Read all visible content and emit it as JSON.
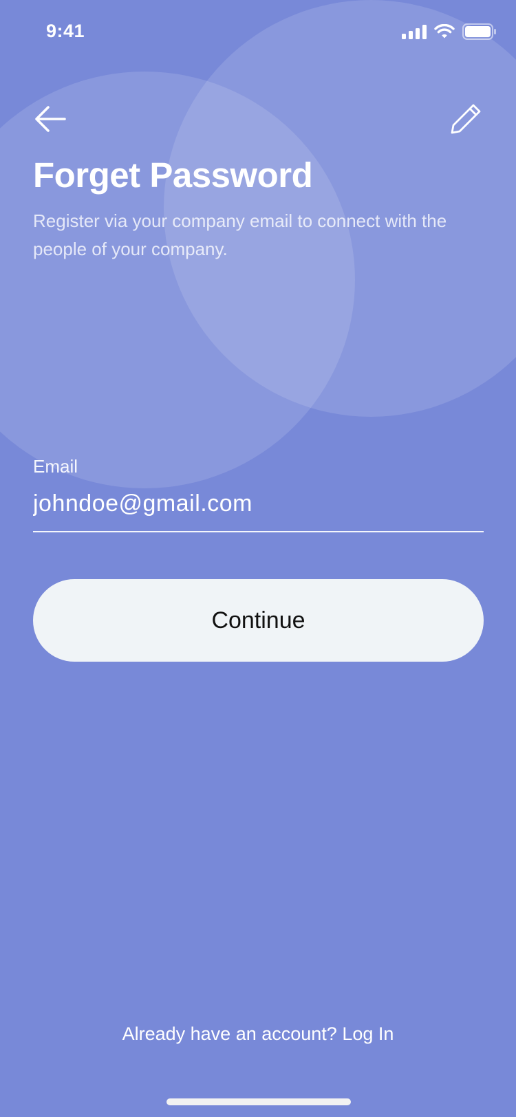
{
  "status_bar": {
    "time": "9:41",
    "signal_icon": "cellular-signal-icon",
    "wifi_icon": "wifi-icon",
    "battery_icon": "battery-icon"
  },
  "nav": {
    "back_icon": "arrow-left-icon",
    "edit_icon": "pencil-icon"
  },
  "header": {
    "title": "Forget Password",
    "subtitle": "Register via your company email to connect with the people of your company."
  },
  "form": {
    "email_label": "Email",
    "email_value": "johndoe@gmail.com",
    "continue_label": "Continue"
  },
  "footer": {
    "prompt": "Already have an account?",
    "login_label": "Log In"
  },
  "colors": {
    "background": "#7889d8",
    "button_background": "#f0f4f7",
    "button_text": "#111111",
    "text": "#ffffff"
  }
}
